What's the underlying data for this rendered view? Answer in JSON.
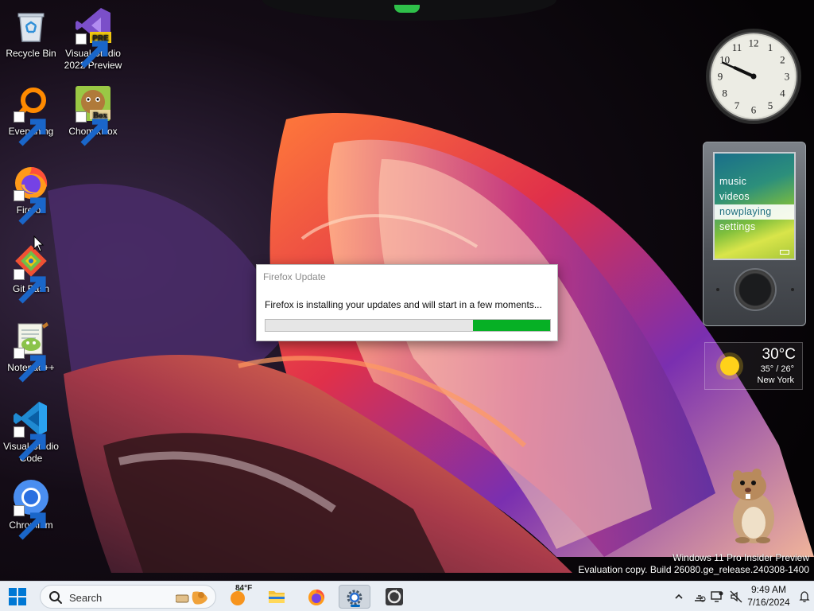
{
  "desktop": {
    "icons": [
      {
        "label": "Recycle Bin",
        "icon": "recycle-bin-icon"
      },
      {
        "label": "Visual Studio 2022 Preview",
        "icon": "visual-studio-preview-icon",
        "badge": "PRE"
      },
      {
        "label": "Everything",
        "icon": "everything-search-icon"
      },
      {
        "label": "ChomikBox",
        "icon": "chomikbox-icon",
        "badge": "Box"
      },
      {
        "label": "Firefox",
        "icon": "firefox-icon"
      },
      {
        "label": "Git Bash",
        "icon": "git-bash-icon"
      },
      {
        "label": "Notepad++",
        "icon": "notepad-plus-plus-icon"
      },
      {
        "label": "Visual Studio Code",
        "icon": "vscode-icon"
      },
      {
        "label": "Chromium",
        "icon": "chromium-icon"
      }
    ]
  },
  "gadgets": {
    "clock": {
      "hour": 9,
      "minute": 49
    },
    "zune": {
      "menu": [
        "music",
        "videos",
        "nowplaying",
        "settings"
      ],
      "active_index": 2
    },
    "weather": {
      "temperature": "30°C",
      "range": "35° / 26°",
      "city": "New York",
      "icon": "sun-icon"
    }
  },
  "dialog": {
    "title": "Firefox Update",
    "message": "Firefox is installing your updates and will start in a few moments...",
    "progress": {
      "start_fraction": 0.73,
      "end_fraction": 1.0,
      "color": "#06b025"
    }
  },
  "watermark": {
    "line1": "Windows 11 Pro Insider Preview",
    "line2": "Evaluation copy. Build 26080.ge_release.240308-1400"
  },
  "taskbar": {
    "search_label": "Search",
    "weather_temp": "84°F",
    "pinned": [
      {
        "name": "weather-widget",
        "icon": "weather-orange-icon",
        "active": false
      },
      {
        "name": "file-explorer",
        "icon": "folder-icon",
        "active": false
      },
      {
        "name": "firefox",
        "icon": "firefox-icon",
        "active": false
      },
      {
        "name": "settings",
        "icon": "gear-icon",
        "active": true
      },
      {
        "name": "firefox-updater",
        "icon": "updater-icon",
        "active": false
      }
    ],
    "clock": {
      "time": "9:49 AM",
      "date": "7/16/2024"
    }
  }
}
